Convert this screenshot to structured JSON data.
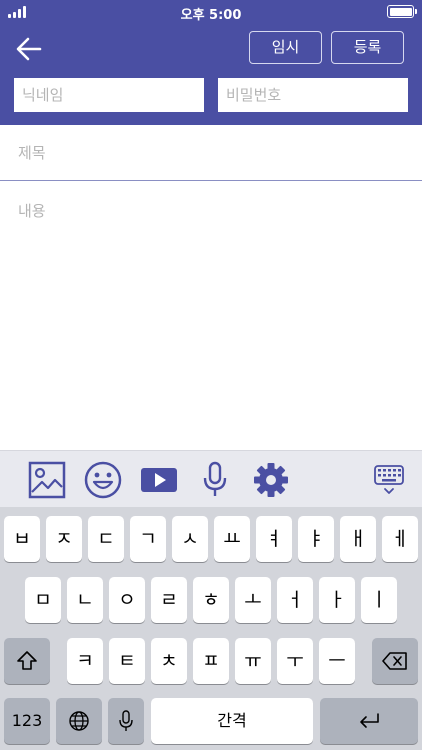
{
  "status": {
    "time": "오후 5:00"
  },
  "header": {
    "temp_save_label": "임시",
    "register_label": "등록",
    "nickname_placeholder": "닉네임",
    "password_placeholder": "비밀번호"
  },
  "form": {
    "title_placeholder": "제목",
    "content_placeholder": "내용"
  },
  "toolbar": {
    "accent_color": "#4a4fa3",
    "icons": [
      "image-icon",
      "emoji-icon",
      "video-icon",
      "microphone-icon",
      "settings-icon",
      "keyboard-hide-icon"
    ]
  },
  "keyboard": {
    "row1": [
      "ㅂ",
      "ㅈ",
      "ㄷ",
      "ㄱ",
      "ㅅ",
      "ㅛ",
      "ㅕ",
      "ㅑ",
      "ㅐ",
      "ㅔ"
    ],
    "row2": [
      "ㅁ",
      "ㄴ",
      "ㅇ",
      "ㄹ",
      "ㅎ",
      "ㅗ",
      "ㅓ",
      "ㅏ",
      "ㅣ"
    ],
    "row3": [
      "ㅋ",
      "ㅌ",
      "ㅊ",
      "ㅍ",
      "ㅠ",
      "ㅜ",
      "ㅡ"
    ],
    "numbers_label": "123",
    "space_label": "간격"
  },
  "colors": {
    "header_bg": "#4a4fa3",
    "keyboard_bg": "#d3d5db"
  }
}
